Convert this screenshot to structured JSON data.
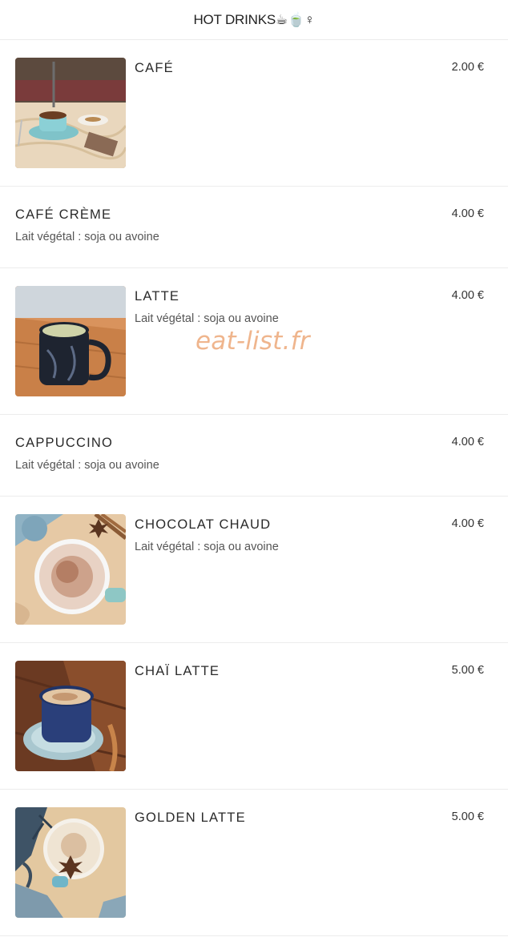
{
  "header": {
    "title": "HOT DRINKS☕🍵♀"
  },
  "items": [
    {
      "name": "CAFÉ",
      "price": "2.00 €",
      "description": "",
      "image": "cafe-photo"
    },
    {
      "name": "CAFÉ CRÈME",
      "price": "4.00 €",
      "description": "Lait végétal : soja ou avoine",
      "image": ""
    },
    {
      "name": "LATTE",
      "price": "4.00 €",
      "description": "Lait végétal : soja ou avoine",
      "image": "latte-photo"
    },
    {
      "name": "CAPPUCCINO",
      "price": "4.00 €",
      "description": "Lait végétal : soja ou avoine",
      "image": ""
    },
    {
      "name": "CHOCOLAT CHAUD",
      "price": "4.00 €",
      "description": "Lait végétal : soja ou avoine",
      "image": "chocolat-photo"
    },
    {
      "name": "CHAÏ LATTE",
      "price": "5.00 €",
      "description": "",
      "image": "chai-photo"
    },
    {
      "name": "GOLDEN LATTE",
      "price": "5.00 €",
      "description": "",
      "image": "golden-latte-photo"
    }
  ],
  "watermark": "eat-list.fr",
  "colors": {
    "watermark": "#eda97a",
    "divider": "#ececec"
  }
}
